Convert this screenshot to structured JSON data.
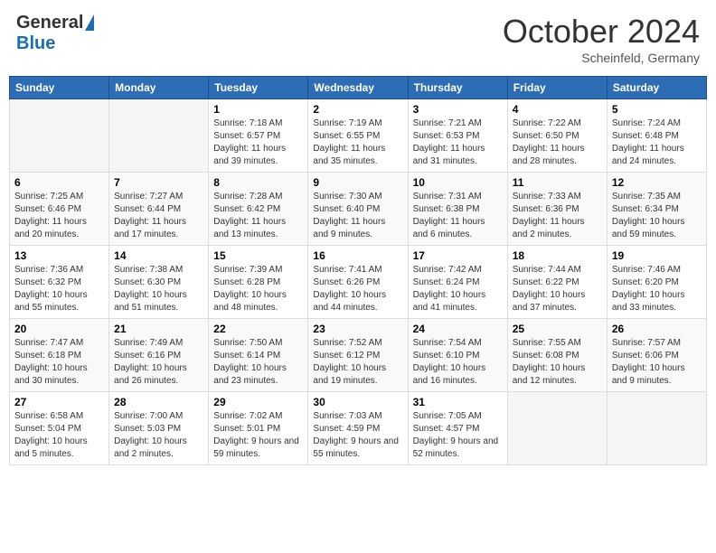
{
  "header": {
    "logo_general": "General",
    "logo_blue": "Blue",
    "month_year": "October 2024",
    "location": "Scheinfeld, Germany"
  },
  "days_of_week": [
    "Sunday",
    "Monday",
    "Tuesday",
    "Wednesday",
    "Thursday",
    "Friday",
    "Saturday"
  ],
  "weeks": [
    [
      {
        "day": "",
        "info": ""
      },
      {
        "day": "",
        "info": ""
      },
      {
        "day": "1",
        "info": "Sunrise: 7:18 AM\nSunset: 6:57 PM\nDaylight: 11 hours and 39 minutes."
      },
      {
        "day": "2",
        "info": "Sunrise: 7:19 AM\nSunset: 6:55 PM\nDaylight: 11 hours and 35 minutes."
      },
      {
        "day": "3",
        "info": "Sunrise: 7:21 AM\nSunset: 6:53 PM\nDaylight: 11 hours and 31 minutes."
      },
      {
        "day": "4",
        "info": "Sunrise: 7:22 AM\nSunset: 6:50 PM\nDaylight: 11 hours and 28 minutes."
      },
      {
        "day": "5",
        "info": "Sunrise: 7:24 AM\nSunset: 6:48 PM\nDaylight: 11 hours and 24 minutes."
      }
    ],
    [
      {
        "day": "6",
        "info": "Sunrise: 7:25 AM\nSunset: 6:46 PM\nDaylight: 11 hours and 20 minutes."
      },
      {
        "day": "7",
        "info": "Sunrise: 7:27 AM\nSunset: 6:44 PM\nDaylight: 11 hours and 17 minutes."
      },
      {
        "day": "8",
        "info": "Sunrise: 7:28 AM\nSunset: 6:42 PM\nDaylight: 11 hours and 13 minutes."
      },
      {
        "day": "9",
        "info": "Sunrise: 7:30 AM\nSunset: 6:40 PM\nDaylight: 11 hours and 9 minutes."
      },
      {
        "day": "10",
        "info": "Sunrise: 7:31 AM\nSunset: 6:38 PM\nDaylight: 11 hours and 6 minutes."
      },
      {
        "day": "11",
        "info": "Sunrise: 7:33 AM\nSunset: 6:36 PM\nDaylight: 11 hours and 2 minutes."
      },
      {
        "day": "12",
        "info": "Sunrise: 7:35 AM\nSunset: 6:34 PM\nDaylight: 10 hours and 59 minutes."
      }
    ],
    [
      {
        "day": "13",
        "info": "Sunrise: 7:36 AM\nSunset: 6:32 PM\nDaylight: 10 hours and 55 minutes."
      },
      {
        "day": "14",
        "info": "Sunrise: 7:38 AM\nSunset: 6:30 PM\nDaylight: 10 hours and 51 minutes."
      },
      {
        "day": "15",
        "info": "Sunrise: 7:39 AM\nSunset: 6:28 PM\nDaylight: 10 hours and 48 minutes."
      },
      {
        "day": "16",
        "info": "Sunrise: 7:41 AM\nSunset: 6:26 PM\nDaylight: 10 hours and 44 minutes."
      },
      {
        "day": "17",
        "info": "Sunrise: 7:42 AM\nSunset: 6:24 PM\nDaylight: 10 hours and 41 minutes."
      },
      {
        "day": "18",
        "info": "Sunrise: 7:44 AM\nSunset: 6:22 PM\nDaylight: 10 hours and 37 minutes."
      },
      {
        "day": "19",
        "info": "Sunrise: 7:46 AM\nSunset: 6:20 PM\nDaylight: 10 hours and 33 minutes."
      }
    ],
    [
      {
        "day": "20",
        "info": "Sunrise: 7:47 AM\nSunset: 6:18 PM\nDaylight: 10 hours and 30 minutes."
      },
      {
        "day": "21",
        "info": "Sunrise: 7:49 AM\nSunset: 6:16 PM\nDaylight: 10 hours and 26 minutes."
      },
      {
        "day": "22",
        "info": "Sunrise: 7:50 AM\nSunset: 6:14 PM\nDaylight: 10 hours and 23 minutes."
      },
      {
        "day": "23",
        "info": "Sunrise: 7:52 AM\nSunset: 6:12 PM\nDaylight: 10 hours and 19 minutes."
      },
      {
        "day": "24",
        "info": "Sunrise: 7:54 AM\nSunset: 6:10 PM\nDaylight: 10 hours and 16 minutes."
      },
      {
        "day": "25",
        "info": "Sunrise: 7:55 AM\nSunset: 6:08 PM\nDaylight: 10 hours and 12 minutes."
      },
      {
        "day": "26",
        "info": "Sunrise: 7:57 AM\nSunset: 6:06 PM\nDaylight: 10 hours and 9 minutes."
      }
    ],
    [
      {
        "day": "27",
        "info": "Sunrise: 6:58 AM\nSunset: 5:04 PM\nDaylight: 10 hours and 5 minutes."
      },
      {
        "day": "28",
        "info": "Sunrise: 7:00 AM\nSunset: 5:03 PM\nDaylight: 10 hours and 2 minutes."
      },
      {
        "day": "29",
        "info": "Sunrise: 7:02 AM\nSunset: 5:01 PM\nDaylight: 9 hours and 59 minutes."
      },
      {
        "day": "30",
        "info": "Sunrise: 7:03 AM\nSunset: 4:59 PM\nDaylight: 9 hours and 55 minutes."
      },
      {
        "day": "31",
        "info": "Sunrise: 7:05 AM\nSunset: 4:57 PM\nDaylight: 9 hours and 52 minutes."
      },
      {
        "day": "",
        "info": ""
      },
      {
        "day": "",
        "info": ""
      }
    ]
  ]
}
